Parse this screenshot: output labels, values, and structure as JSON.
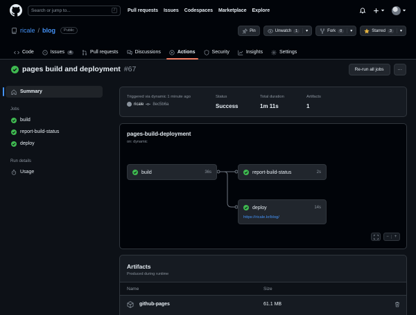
{
  "header": {
    "search_placeholder": "Search or jump to...",
    "search_kbd": "/",
    "nav": [
      "Pull requests",
      "Issues",
      "Codespaces",
      "Marketplace",
      "Explore"
    ]
  },
  "repo": {
    "owner": "ricale",
    "separator": "/",
    "name": "blog",
    "visibility": "Public",
    "pin_label": "Pin",
    "unwatch_label": "Unwatch",
    "unwatch_count": "1",
    "fork_label": "Fork",
    "fork_count": "0",
    "starred_label": "Starred",
    "star_count": "3"
  },
  "tabs": [
    {
      "label": "Code",
      "icon": "code-icon"
    },
    {
      "label": "Issues",
      "count": "4",
      "icon": "issue-icon"
    },
    {
      "label": "Pull requests",
      "icon": "pull-request-icon"
    },
    {
      "label": "Discussions",
      "icon": "discussion-icon"
    },
    {
      "label": "Actions",
      "icon": "play-icon",
      "active": true
    },
    {
      "label": "Security",
      "icon": "shield-icon"
    },
    {
      "label": "Insights",
      "icon": "graph-icon"
    },
    {
      "label": "Settings",
      "icon": "gear-icon"
    }
  ],
  "run": {
    "title": "pages build and deployment",
    "number": "#67",
    "rerun_label": "Re-run all jobs",
    "more_label": "···"
  },
  "sidebar": {
    "summary": "Summary",
    "jobs_heading": "Jobs",
    "jobs": [
      "build",
      "report-build-status",
      "deploy"
    ],
    "run_details_heading": "Run details",
    "usage": "Usage"
  },
  "summary": {
    "triggered": "Triggered via dynamic 1 minute ago",
    "actor": "ricale",
    "commit": "8ec5b6a",
    "status_label": "Status",
    "status_value": "Success",
    "duration_label": "Total duration",
    "duration_value": "1m 11s",
    "artifacts_label": "Artifacts",
    "artifacts_value": "1"
  },
  "workflow": {
    "title": "pages-build-deployment",
    "subtitle": "on: dynamic",
    "jobs": {
      "build": {
        "name": "build",
        "duration": "36s"
      },
      "report": {
        "name": "report-build-status",
        "duration": "2s"
      },
      "deploy": {
        "name": "deploy",
        "duration": "14s",
        "url": "https://ricale.kr/blog/"
      }
    },
    "zoom_out": "−",
    "zoom_in": "+"
  },
  "artifacts": {
    "title": "Artifacts",
    "subtitle": "Produced during runtime",
    "col_name": "Name",
    "col_size": "Size",
    "rows": [
      {
        "name": "github-pages",
        "size": "61.1 MB"
      }
    ]
  },
  "colors": {
    "success": "#3fb950",
    "accent": "#4493f8",
    "active_tab": "#f78166",
    "bg": "#0d1117"
  }
}
